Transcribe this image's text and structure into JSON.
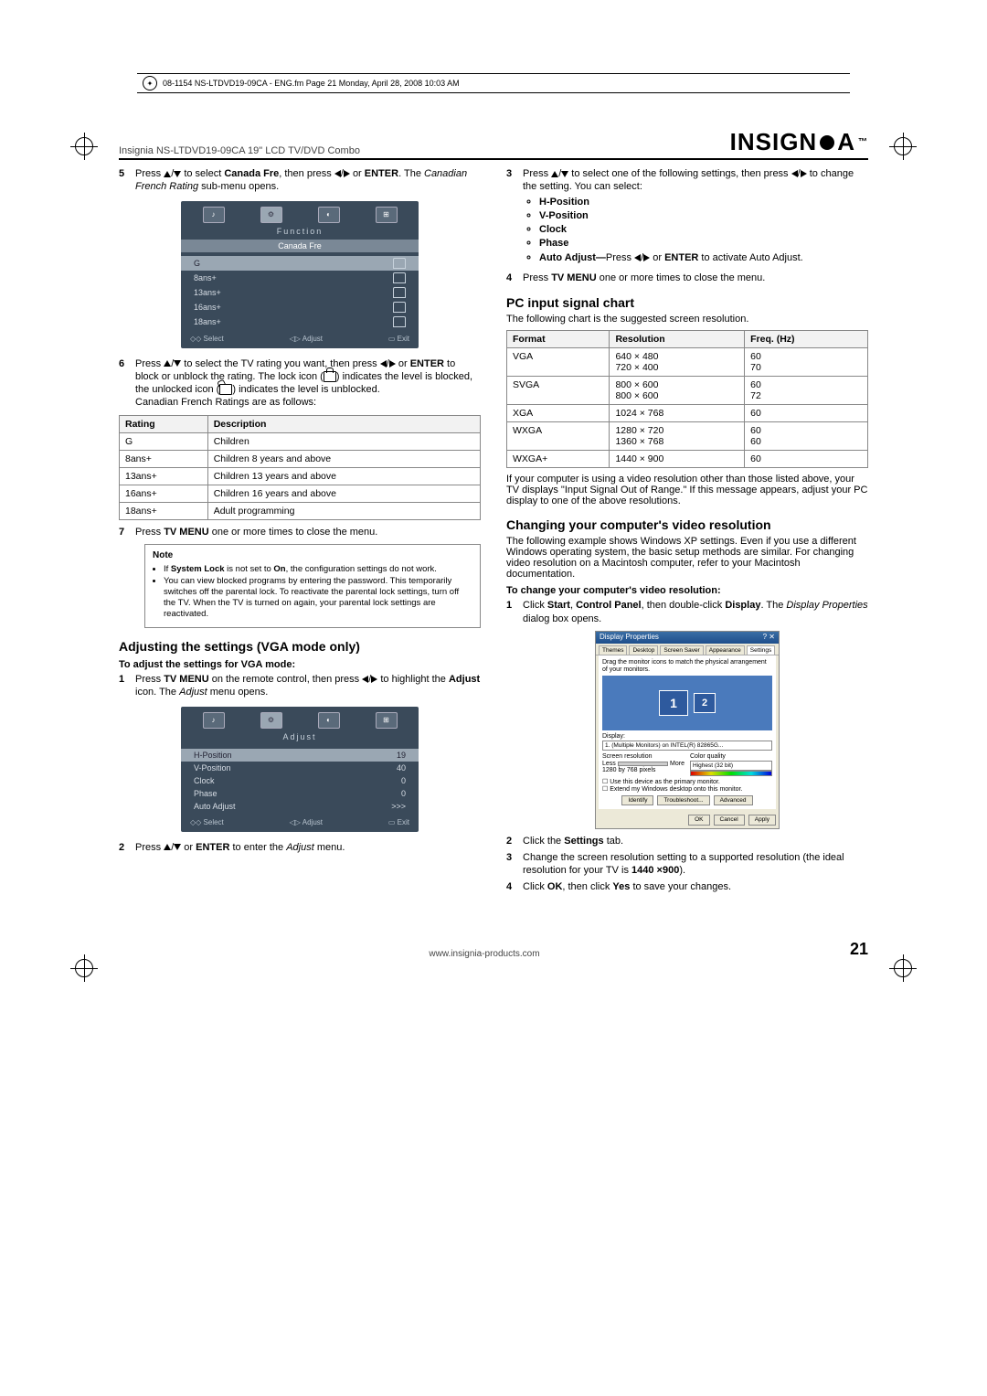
{
  "framemaker_line": "08-1154 NS-LTDVD19-09CA - ENG.fm  Page 21  Monday, April 28, 2008  10:03 AM",
  "product_line": "Insignia NS-LTDVD19-09CA 19\" LCD TV/DVD Combo",
  "brand": "INSIGNIA",
  "left": {
    "step5": {
      "pre": "Press ",
      "mid1": " to select ",
      "bold1": "Canada Fre",
      "mid2": ", then press ",
      "mid3": " or ",
      "bold2": "ENTER",
      "mid4": ". The ",
      "ital": "Canadian French Rating",
      "tail": " sub-menu opens."
    },
    "menu1": {
      "title": "Function",
      "banner": "Canada Fre",
      "rows": [
        "G",
        "8ans+",
        "13ans+",
        "16ans+",
        "18ans+"
      ],
      "footer": {
        "select": "Select",
        "adjust": "Adjust",
        "exit": "Exit"
      }
    },
    "step6": {
      "l1a": "Press ",
      "l1b": " to select the TV rating you want, then press ",
      "l1c": " or ",
      "bold1": "ENTER",
      "l1d": " to block or unblock the rating. The lock icon (",
      "l1e": ") indicates the level is blocked, the unlocked icon (",
      "l1f": ") indicates the level is unblocked.",
      "l2": "Canadian French Ratings are as follows:"
    },
    "ratings_table": {
      "headers": [
        "Rating",
        "Description"
      ],
      "rows": [
        [
          "G",
          "Children"
        ],
        [
          "8ans+",
          "Children 8 years and above"
        ],
        [
          "13ans+",
          "Children 13 years and above"
        ],
        [
          "16ans+",
          "Children 16 years and above"
        ],
        [
          "18ans+",
          "Adult programming"
        ]
      ]
    },
    "step7": {
      "a": "Press ",
      "b": "TV MENU",
      "c": " one or more times to close the menu."
    },
    "note": {
      "title": "Note",
      "b1a": "If ",
      "b1b": "System Lock",
      "b1c": " is not set to ",
      "b1d": "On",
      "b1e": ", the configuration settings do not work.",
      "b2": "You can view blocked programs by entering the password. This temporarily switches off the parental lock. To reactivate the parental lock settings, turn off the TV. When the TV is turned on again, your parental lock settings are reactivated."
    },
    "h_adjust": "Adjusting the settings (VGA mode only)",
    "h_adjust_sub": "To adjust the settings for VGA mode:",
    "astep1": {
      "a": "Press ",
      "b": "TV MENU",
      "c": " on the remote control, then press ",
      "d": " to highlight the ",
      "e": "Adjust",
      "f": " icon. The ",
      "g": "Adjust",
      "h": " menu opens."
    },
    "menu2": {
      "title": "Adjust",
      "rows": [
        {
          "k": "H-Position",
          "v": "19"
        },
        {
          "k": "V-Position",
          "v": "40"
        },
        {
          "k": "Clock",
          "v": "0"
        },
        {
          "k": "Phase",
          "v": "0"
        },
        {
          "k": "Auto Adjust",
          "v": ">>>"
        }
      ],
      "footer": {
        "select": "Select",
        "adjust": "Adjust",
        "exit": "Exit"
      }
    },
    "astep2": {
      "a": "Press ",
      "b": " or ",
      "c": "ENTER",
      "d": " to enter the ",
      "e": "Adjust",
      "f": " menu."
    }
  },
  "right": {
    "step3": {
      "a": "Press ",
      "b": " to select one of the following settings, then press ",
      "c": " to change the setting. You can select:"
    },
    "opts": [
      "H-Position",
      "V-Position",
      "Clock",
      "Phase"
    ],
    "opt_auto": {
      "a": "Auto Adjust—",
      "b": "Press ",
      "c": " or ",
      "d": "ENTER",
      "e": " to activate Auto Adjust."
    },
    "step4": {
      "a": "Press ",
      "b": "TV MENU",
      "c": " one or more times to close the menu."
    },
    "h_pc": "PC input signal chart",
    "pc_intro": "The following chart is the suggested screen resolution.",
    "pc_table": {
      "headers": [
        "Format",
        "Resolution",
        "Freq. (Hz)"
      ],
      "rows": [
        [
          "VGA",
          "640 × 480\n720 × 400",
          "60\n70"
        ],
        [
          "SVGA",
          "800 × 600\n800 × 600",
          "60\n72"
        ],
        [
          "XGA",
          "1024 × 768",
          "60"
        ],
        [
          "WXGA",
          "1280 × 720\n1360 × 768",
          "60\n60"
        ],
        [
          "WXGA+",
          "1440 × 900",
          "60"
        ]
      ]
    },
    "pc_outro": "If your computer is using a video resolution other than those listed above, your TV displays \"Input Signal Out of Range.\" If this message appears, adjust your PC display to one of the above resolutions.",
    "h_change": "Changing your computer's video resolution",
    "change_intro": "The following example shows Windows XP settings. Even if you use a different Windows operating system, the basic setup methods are similar. For changing video resolution on a Macintosh computer, refer to your Macintosh documentation.",
    "change_sub": "To change your computer's video resolution:",
    "cstep1": {
      "a": "Click ",
      "b": "Start",
      "c": ", ",
      "d": "Control Panel",
      "e": ", then double-click ",
      "f": "Display",
      "g": ". The ",
      "h": "Display Properties",
      "i": " dialog box opens."
    },
    "win": {
      "title": "Display Properties",
      "tabs": [
        "Themes",
        "Desktop",
        "Screen Saver",
        "Appearance",
        "Settings"
      ],
      "drag": "Drag the monitor icons to match the physical arrangement of your monitors.",
      "m1": "1",
      "m2": "2",
      "display": "Display:",
      "disp_val": "1. (Multiple Monitors) on INTEL(R) 82865G...",
      "sr": "Screen resolution",
      "cq": "Color quality",
      "less": "Less",
      "more": "More",
      "hq": "Highest (32 bit)",
      "res": "1280 by 768 pixels",
      "chk1": "Use this device as the primary monitor.",
      "chk2": "Extend my Windows desktop onto this monitor.",
      "btns": [
        "Identify",
        "Troubleshoot...",
        "Advanced"
      ],
      "foot": [
        "OK",
        "Cancel",
        "Apply"
      ]
    },
    "cstep2": {
      "a": "Click the ",
      "b": "Settings",
      "c": " tab."
    },
    "cstep3": {
      "a": "Change the screen resolution setting to a supported resolution (the ideal resolution for your TV is ",
      "b": "1440 ×900",
      "c": ")."
    },
    "cstep4": {
      "a": "Click ",
      "b": "OK",
      "c": ", then click ",
      "d": "Yes",
      "e": " to save your changes."
    }
  },
  "footer": {
    "url": "www.insignia-products.com",
    "page": "21"
  }
}
